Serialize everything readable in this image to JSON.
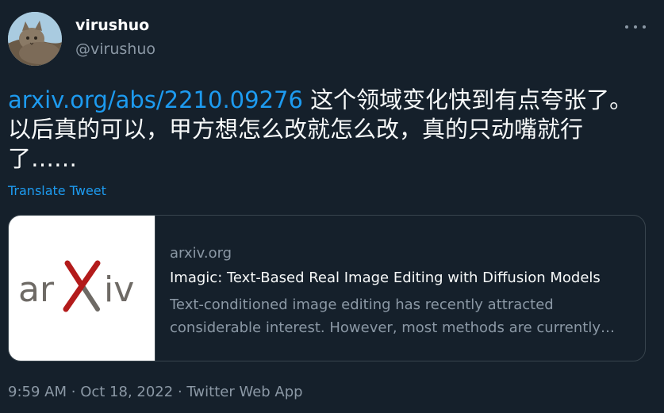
{
  "author": {
    "display_name": "virushuo",
    "handle": "@virushuo"
  },
  "tweet": {
    "link_text": "arxiv.org/abs/2210.09276",
    "text": " 这个领域变化快到有点夸张了。以后真的可以，甲方想怎么改就怎么改，真的只动嘴就行了……",
    "translate_label": "Translate Tweet",
    "time": "9:59 AM",
    "date": "Oct 18, 2022",
    "source": "Twitter Web App",
    "separator": "·"
  },
  "card": {
    "domain": "arxiv.org",
    "title": "Imagic: Text-Based Real Image Editing with Diffusion Models",
    "description": "Text-conditioned image editing has recently attracted considerable interest. However, most methods are currently…",
    "logo_text": "arXiv"
  },
  "icons": {
    "more": "more-horizontal-icon"
  },
  "colors": {
    "background": "#15202b",
    "link": "#1d9bf0",
    "muted": "#8b98a5",
    "text": "#f7f9f9",
    "border": "#38444d",
    "arxiv_red": "#b31b1b",
    "arxiv_gray": "#6e6a65"
  }
}
